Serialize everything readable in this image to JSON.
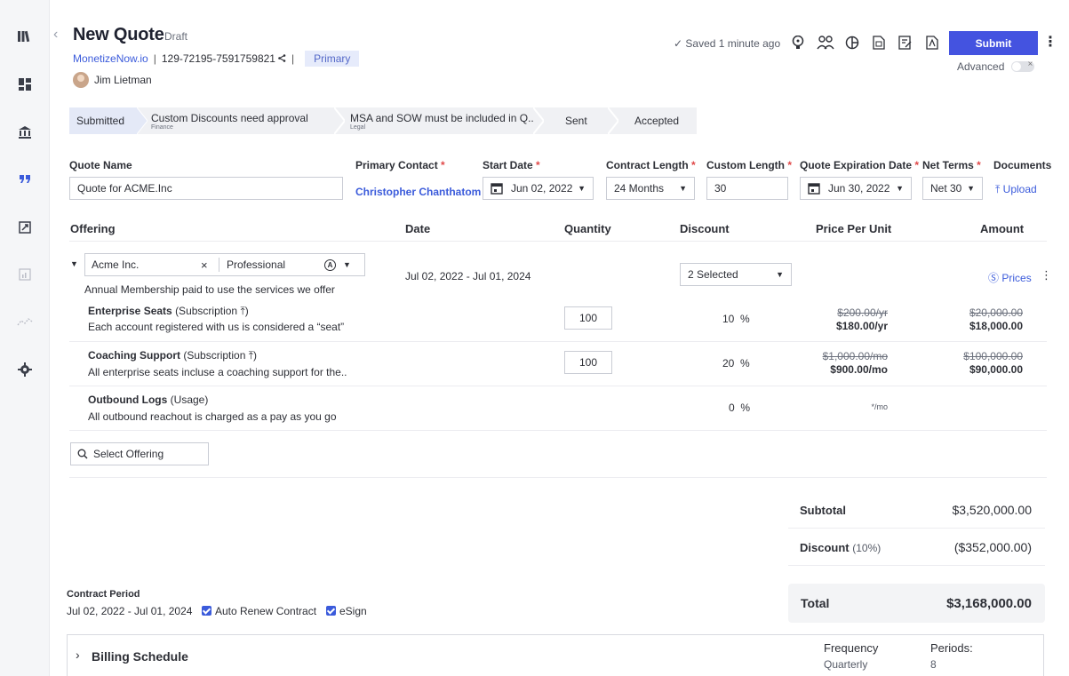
{
  "header": {
    "title": "New Quote",
    "status": "Draft",
    "company_link": "MonetizeNow.io",
    "quote_id": "129-72195-7591759821",
    "primary_tag": "Primary",
    "owner": "Jim Lietman",
    "saved_text": "✓ Saved 1 minute ago",
    "submit_label": "Submit",
    "advanced_label": "Advanced"
  },
  "steps": [
    {
      "label": "Submitted",
      "sub": ""
    },
    {
      "label": "Custom Discounts need approval",
      "sub": "Finance"
    },
    {
      "label": "MSA and SOW must be included in Q..",
      "sub": "Legal"
    },
    {
      "label": "Sent",
      "sub": ""
    },
    {
      "label": "Accepted",
      "sub": ""
    }
  ],
  "form": {
    "quote_name_label": "Quote Name",
    "quote_name_value": "Quote for ACME.Inc",
    "primary_contact_label": "Primary Contact",
    "primary_contact_value": "Christopher Chanthatom",
    "start_date_label": "Start Date",
    "start_date_value": "Jun 02, 2022",
    "contract_length_label": "Contract Length",
    "contract_length_value": "24 Months",
    "custom_length_label": "Custom Length",
    "custom_length_value": "30",
    "expiration_label": "Quote Expiration Date",
    "expiration_value": "Jun 30, 2022",
    "net_terms_label": "Net Terms",
    "net_terms_value": "Net 30",
    "documents_label": "Documents",
    "upload_label": "Upload",
    "required_mark": "*"
  },
  "table": {
    "headers": {
      "offering": "Offering",
      "date": "Date",
      "quantity": "Quantity",
      "discount": "Discount",
      "price_per_unit": "Price Per Unit",
      "amount": "Amount"
    },
    "offering": {
      "account": "Acme Inc.",
      "plan": "Professional",
      "plan_badge": "A",
      "description": "Annual Membership paid to use the services we offer",
      "date_range": "Jul 02, 2022 - Jul 01, 2024",
      "discount_select": "2 Selected",
      "prices_link": "Prices"
    },
    "rows": [
      {
        "name": "Enterprise Seats",
        "type": "(Subscription",
        "type_close": ")",
        "desc": "Each account registered with us is considered a “seat”",
        "qty": "100",
        "discount": "10",
        "pct": "%",
        "old_price": "$200.00/yr",
        "new_price": "$180.00/yr",
        "old_amount": "$20,000.00",
        "new_amount": "$18,000.00"
      },
      {
        "name": "Coaching Support",
        "type": "(Subscription",
        "type_close": ")",
        "desc": "All enterprise seats incluse a coaching support for the..",
        "qty": "100",
        "discount": "20",
        "pct": "%",
        "old_price": "$1,000.00/mo",
        "new_price": "$900.00/mo",
        "old_amount": "$100,000.00",
        "new_amount": "$90,000.00"
      },
      {
        "name": "Outbound Logs",
        "type": "(Usage)",
        "desc": "All outbound reachout is charged as a pay as you go",
        "discount": "0",
        "pct": "%",
        "price": "*/mo"
      }
    ],
    "select_offering_placeholder": "Select Offering"
  },
  "totals": {
    "subtotal_label": "Subtotal",
    "subtotal_value": "$3,520,000.00",
    "discount_label": "Discount",
    "discount_pct": "(10%)",
    "discount_value": "($352,000.00)",
    "total_label": "Total",
    "total_value": "$3,168,000.00"
  },
  "contract": {
    "period_label": "Contract Period",
    "period_value": "Jul 02, 2022 - Jul 01, 2024",
    "auto_renew_label": "Auto Renew Contract",
    "esign_label": "eSign"
  },
  "billing": {
    "title": "Billing Schedule",
    "frequency_label": "Frequency",
    "frequency_value": "Quarterly",
    "periods_label": "Periods:",
    "periods_value": "8"
  },
  "icons": {
    "rail": [
      "library-icon",
      "dashboard-icon",
      "bank-icon",
      "quote-icon",
      "invoice-icon",
      "report-icon",
      "analytics-icon",
      "settings-icon"
    ],
    "header": [
      "idea-icon",
      "users-icon",
      "pie-chart-icon",
      "document-icon",
      "edit-document-icon",
      "pdf-icon"
    ]
  },
  "colors": {
    "accent": "#4453e0",
    "link": "#3b5bdb",
    "required": "#e04848",
    "tag_bg": "#e6ebfb"
  }
}
